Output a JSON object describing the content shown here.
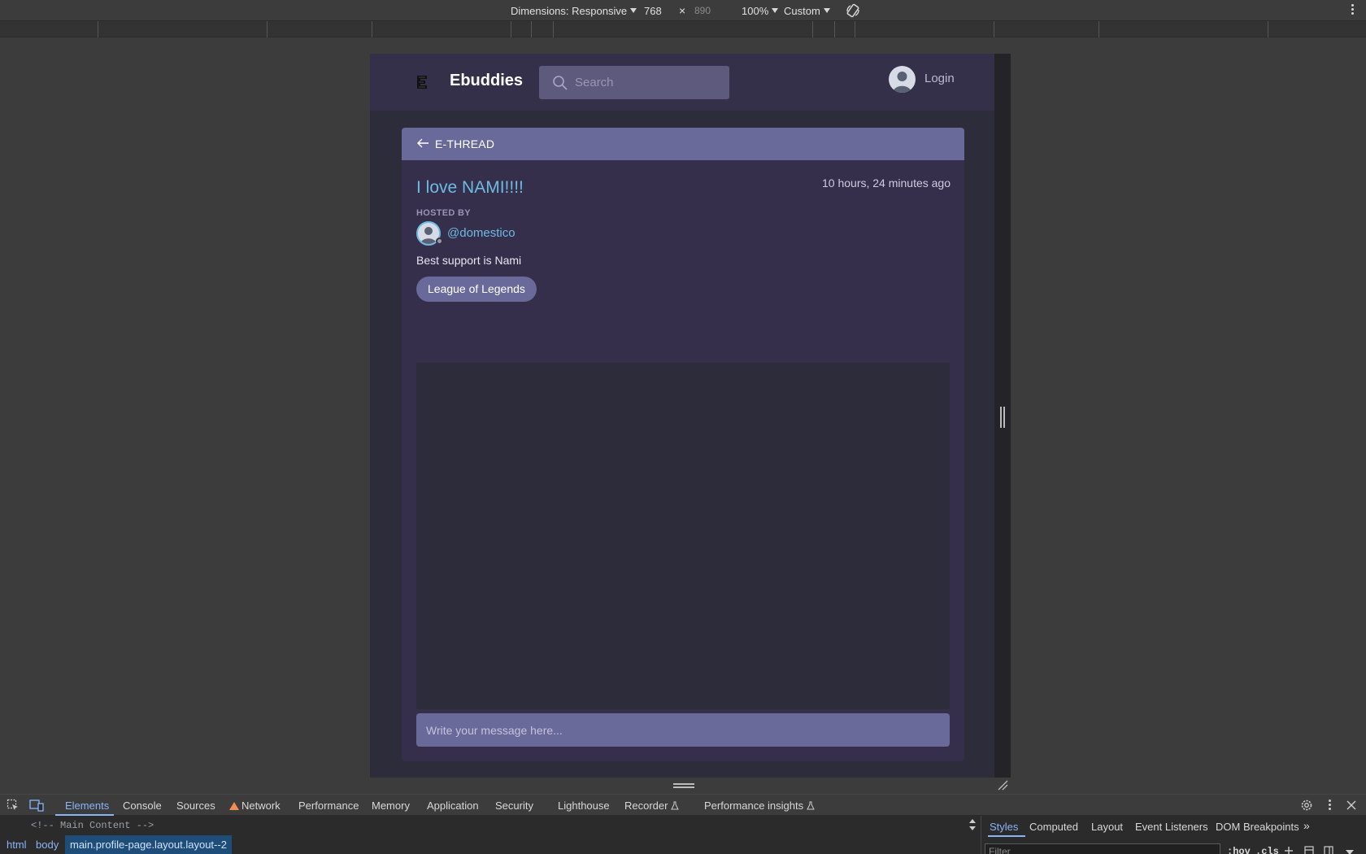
{
  "devtools": {
    "dimensions_label": "Dimensions: Responsive",
    "width_value": "768",
    "times": "×",
    "height_value": "890",
    "zoom": "100%",
    "throttle": "Custom",
    "tabs": [
      "Elements",
      "Console",
      "Sources",
      "Network",
      "Performance",
      "Memory",
      "Application",
      "Security",
      "Lighthouse",
      "Recorder",
      "Performance insights"
    ],
    "code_line": "<!-- Main Content -->",
    "breadcrumbs": [
      "html",
      "body",
      "main.profile-page.layout.layout--2"
    ],
    "styles_tabs": [
      "Styles",
      "Computed",
      "Layout",
      "Event Listeners",
      "DOM Breakpoints"
    ],
    "more_tabs": "»",
    "filter_placeholder": "Filter",
    "hov": ":hov",
    "cls": ".cls"
  },
  "site": {
    "brand": "Ebuddies",
    "search_placeholder": "Search",
    "login": "Login"
  },
  "thread": {
    "header_label": "E-THREAD",
    "title": "I love NAMI!!!!",
    "timestamp": "10 hours, 24 minutes ago",
    "hosted_by": "HOSTED BY",
    "host": "@domestico",
    "description": "Best support is Nami",
    "topic": "League of Legends",
    "message_placeholder": "Write your message here..."
  },
  "colors": {
    "header_bg": "#343049",
    "card_bg": "#352f4b",
    "accent": "#6a6a9a",
    "link": "#6dbbe4"
  }
}
